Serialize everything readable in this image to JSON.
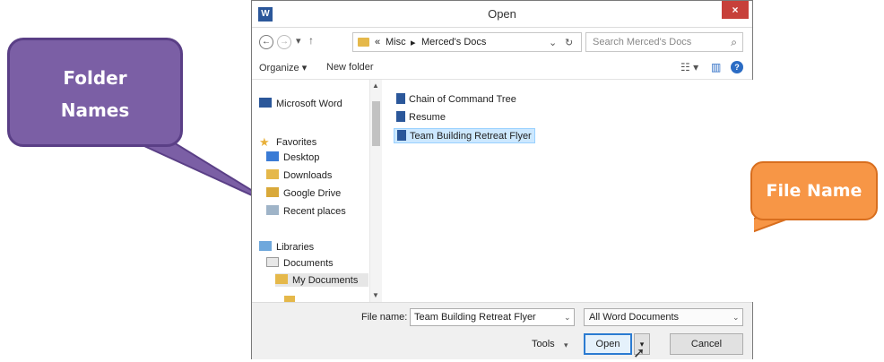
{
  "dialog": {
    "app_icon_letter": "W",
    "title": "Open",
    "close_glyph": "×"
  },
  "nav": {
    "back_glyph": "←",
    "forward_glyph": "→",
    "dropdown_glyph": "▾",
    "up_glyph": "↑",
    "breadcrumb_prefix": "«",
    "breadcrumb_parts": [
      "Misc",
      "Merced's Docs"
    ],
    "breadcrumb_sep": "▸",
    "address_dropdown_glyph": "⌄",
    "refresh_glyph": "↻",
    "search_placeholder": "Search Merced's Docs",
    "search_glyph": "⌕"
  },
  "toolbar": {
    "organize_label": "Organize ▾",
    "new_folder_label": "New folder",
    "view_glyph": "☷ ▾",
    "pane_glyph": "▥",
    "help_glyph": "?"
  },
  "sidebar": {
    "items": [
      {
        "label": "Microsoft Word",
        "icon": "word-icon"
      },
      {
        "label": "Favorites",
        "icon": "star-icon"
      },
      {
        "label": "Desktop",
        "icon": "desktop-icon"
      },
      {
        "label": "Downloads",
        "icon": "downloads-icon"
      },
      {
        "label": "Google Drive",
        "icon": "google-drive-icon"
      },
      {
        "label": "Recent places",
        "icon": "recent-places-icon"
      },
      {
        "label": "Libraries",
        "icon": "libraries-icon"
      },
      {
        "label": "Documents",
        "icon": "documents-icon"
      },
      {
        "label": "My Documents",
        "icon": "folder-icon"
      }
    ]
  },
  "files": {
    "items": [
      {
        "name": "Chain of Command Tree"
      },
      {
        "name": "Resume"
      },
      {
        "name": "Team Building Retreat Flyer"
      }
    ]
  },
  "bottom": {
    "file_name_label": "File name:",
    "file_name_value": "Team Building Retreat Flyer",
    "file_type_value": "All Word Documents",
    "tools_label": "Tools",
    "open_label": "Open",
    "cancel_label": "Cancel"
  },
  "callouts": {
    "folder_line1": "Folder",
    "folder_line2": "Names",
    "file_name": "File Name"
  },
  "colors": {
    "folder_callout": "#7b5fa5",
    "file_callout": "#f79646",
    "selection": "#cce8ff",
    "word_blue": "#2b579a"
  }
}
